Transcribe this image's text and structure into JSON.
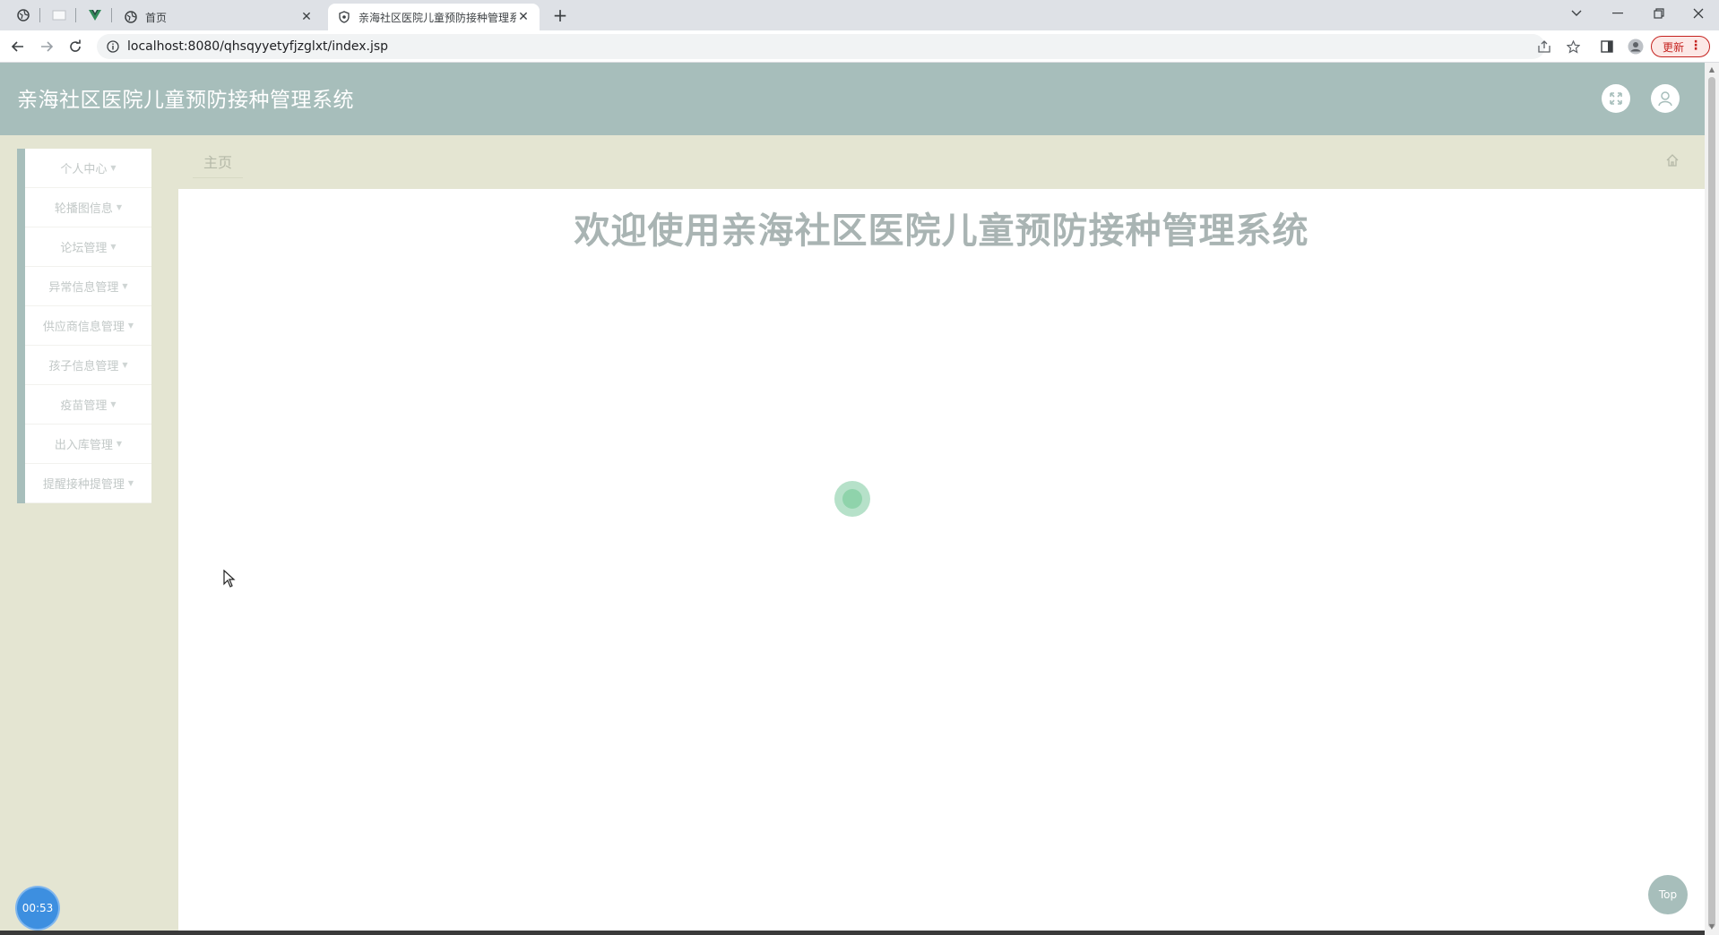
{
  "browser": {
    "tabs": [
      {
        "title": "首页",
        "active": false
      },
      {
        "title": "亲海社区医院儿童预防接种管理系统",
        "active": true
      }
    ],
    "url": "localhost:8080/qhsqyyetyfjzglxt/index.jsp",
    "update_label": "更新"
  },
  "app": {
    "title": "亲海社区医院儿童预防接种管理系统",
    "accent_color": "#a7bebb"
  },
  "sidebar": {
    "items": [
      {
        "label": "个人中心"
      },
      {
        "label": "轮播图信息"
      },
      {
        "label": "论坛管理"
      },
      {
        "label": "异常信息管理"
      },
      {
        "label": "供应商信息管理"
      },
      {
        "label": "孩子信息管理"
      },
      {
        "label": "疫苗管理"
      },
      {
        "label": "出入库管理"
      },
      {
        "label": "提醒接种提管理"
      }
    ]
  },
  "breadcrumb": {
    "current": "主页"
  },
  "main": {
    "welcome": "欢迎使用亲海社区医院儿童预防接种管理系统"
  },
  "widgets": {
    "timer": "00:53",
    "top_label": "Top"
  }
}
